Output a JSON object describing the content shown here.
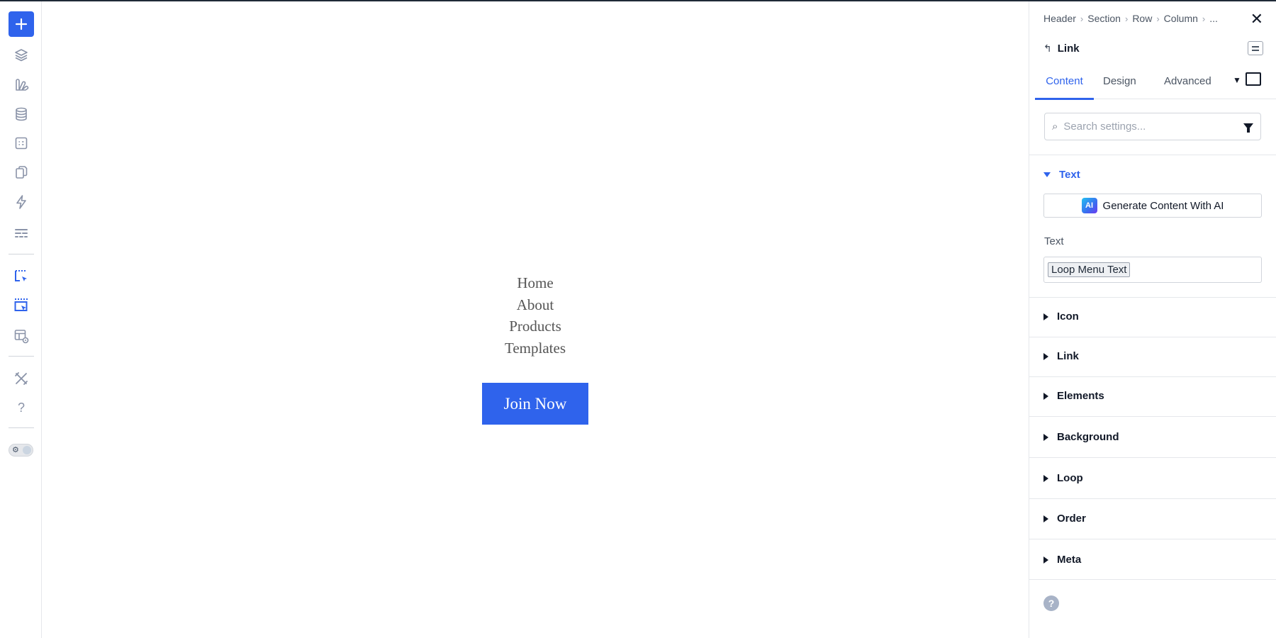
{
  "colors": {
    "accent": "#2f63ec",
    "icon": "#8a93a8",
    "active_icon": "#2f63ec"
  },
  "toolbar": {
    "items": [
      {
        "icon": "plus-icon"
      },
      {
        "icon": "layers-icon"
      },
      {
        "icon": "theme-builder-icon"
      },
      {
        "icon": "database-icon"
      },
      {
        "icon": "form-icon"
      },
      {
        "icon": "pages-icon"
      },
      {
        "icon": "lightning-icon"
      },
      {
        "icon": "sections-icon"
      },
      {
        "icon": "select-element-icon"
      },
      {
        "icon": "select-element-active-icon"
      },
      {
        "icon": "preview-layout-icon"
      },
      {
        "icon": "tools-icon"
      },
      {
        "icon": "help-icon",
        "label": "?"
      },
      {
        "icon": "dark-mode-toggle-icon"
      }
    ]
  },
  "canvas": {
    "menu_items": [
      "Home",
      "About",
      "Products",
      "Templates"
    ],
    "cta_label": "Join Now"
  },
  "panel": {
    "breadcrumbs": [
      "Header",
      "Section",
      "Row",
      "Column",
      "..."
    ],
    "element_title": "Link",
    "tabs": [
      "Content",
      "Design",
      "Advanced"
    ],
    "active_tab": "Content",
    "search_placeholder": "Search settings...",
    "open_section": "Text",
    "ai_button_label": "Generate Content With AI",
    "ai_badge": "AI",
    "text_field_label": "Text",
    "text_field_value": "Loop Menu Text",
    "sections": [
      "Icon",
      "Link",
      "Elements",
      "Background",
      "Loop",
      "Order",
      "Meta"
    ],
    "help": "?"
  }
}
